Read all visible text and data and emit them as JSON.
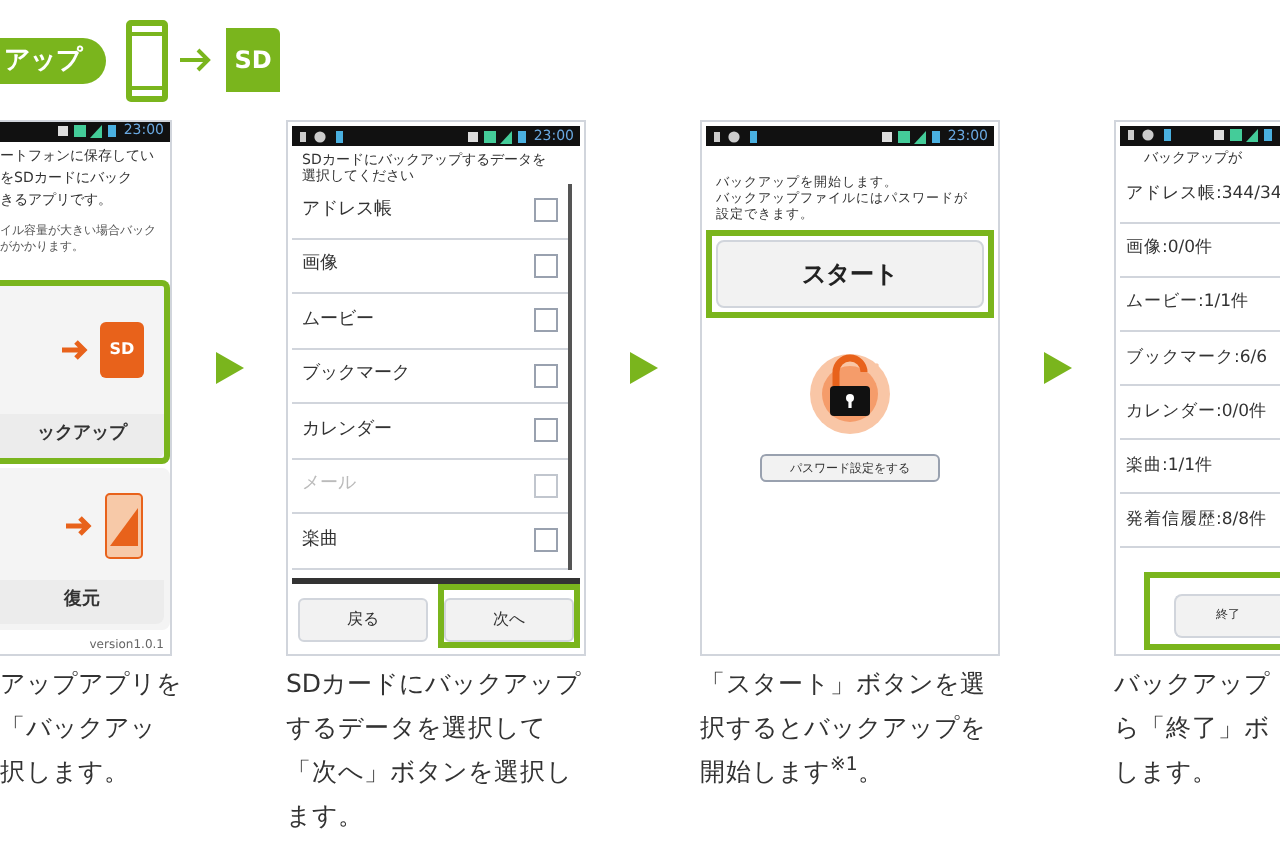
{
  "header": {
    "pill_label": "アップ",
    "sd_label": "SD"
  },
  "steps": [
    {
      "kind": "menu",
      "time": "23:00",
      "intro_lines": [
        "ートフォンに保存してい",
        "をSDカードにバック",
        "きるアプリです。"
      ],
      "note_lines": [
        "イル容量が大きい場合バック",
        "がかかります。"
      ],
      "cards": [
        {
          "kind": "backup",
          "label": "ックアップ",
          "sd_label": "SD",
          "highlighted": true
        },
        {
          "kind": "restore",
          "label": "復元",
          "highlighted": false
        }
      ],
      "version": "version1.0.1",
      "caption_lines": [
        "アップアプリを",
        "「バックアッ",
        "択します。"
      ]
    },
    {
      "kind": "checklist",
      "time": "23:00",
      "prompt_lines": [
        "SDカードにバックアップするデータを",
        "選択してください"
      ],
      "items": [
        {
          "label": "アドレス帳",
          "checked": false,
          "disabled": false
        },
        {
          "label": "画像",
          "checked": false,
          "disabled": false
        },
        {
          "label": "ムービー",
          "checked": false,
          "disabled": false
        },
        {
          "label": "ブックマーク",
          "checked": false,
          "disabled": false
        },
        {
          "label": "カレンダー",
          "checked": false,
          "disabled": false
        },
        {
          "label": "メール",
          "checked": false,
          "disabled": true
        },
        {
          "label": "楽曲",
          "checked": false,
          "disabled": false
        }
      ],
      "buttons": [
        {
          "label": "戻る",
          "highlighted": false
        },
        {
          "label": "次へ",
          "highlighted": true
        }
      ],
      "caption_lines": [
        "SDカードにバックアップ",
        "するデータを選択して",
        "「次へ」ボタンを選択し",
        "ます。"
      ]
    },
    {
      "kind": "start",
      "time": "23:00",
      "message_lines": [
        "バックアップを開始します。",
        "バックアップファイルにはパスワードが",
        "設定できます。"
      ],
      "start_button": {
        "label": "スタート",
        "highlighted": true
      },
      "password_button": "パスワード設定をする",
      "caption_lines": [
        "「スタート」ボタンを選",
        "択するとバックアップを",
        "開始します$^{※1}$。"
      ]
    },
    {
      "kind": "result",
      "title": "バックアップが",
      "items": [
        "アドレス帳:344/34",
        "画像:0/0件",
        "ムービー:1/1件",
        "ブックマーク:6/6",
        "カレンダー:0/0件",
        "楽曲:1/1件",
        "発着信履歴:8/8件"
      ],
      "finish_button": {
        "label": "終了",
        "highlighted": true
      },
      "caption_lines": [
        "バックアップ",
        "ら「終了」ボ",
        "します。"
      ]
    }
  ]
}
